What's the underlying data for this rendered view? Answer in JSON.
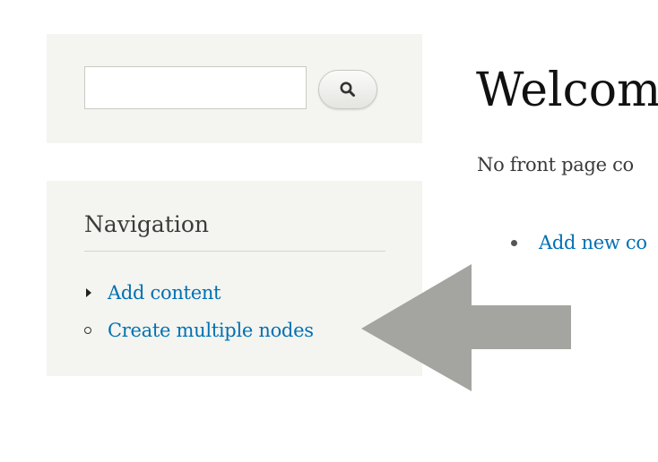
{
  "sidebar": {
    "search": {
      "value": "",
      "placeholder": "",
      "button_icon": "search-icon"
    },
    "navigation": {
      "title": "Navigation",
      "items": [
        {
          "label": "Add content",
          "marker": "collapsed-arrow"
        },
        {
          "label": "Create multiple nodes",
          "marker": "leaf-circle"
        }
      ]
    }
  },
  "main": {
    "title": "Welcom",
    "text": "No front page co",
    "links": [
      {
        "label": "Add new co"
      }
    ]
  },
  "colors": {
    "link": "#0071b3",
    "sidebar_bg": "#f4f4f0",
    "arrow": "#a3a3a0"
  }
}
